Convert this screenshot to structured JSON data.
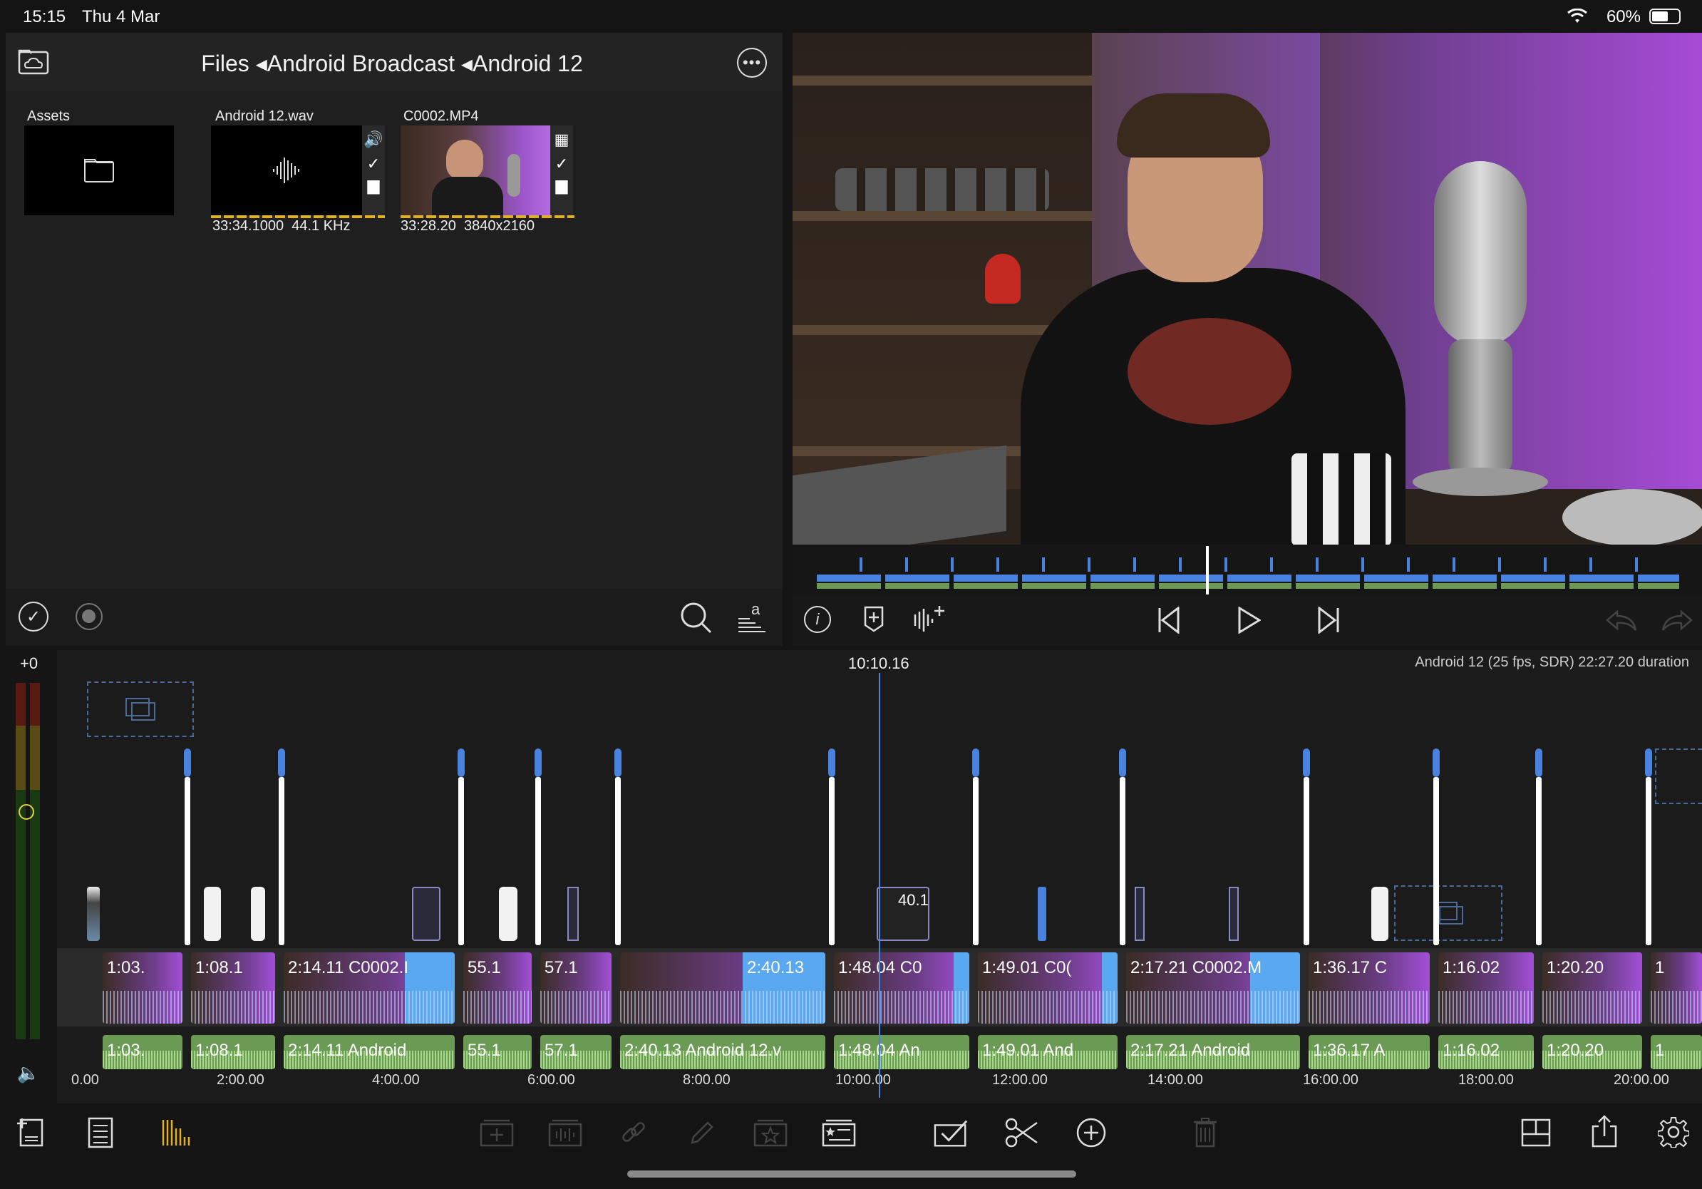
{
  "status": {
    "time": "15:15",
    "date": "Thu 4 Mar",
    "battery": "60%"
  },
  "browser": {
    "breadcrumb": "Files ◂Android Broadcast ◂Android 12",
    "assets": [
      {
        "label": "Assets"
      },
      {
        "label": "Android 12.wav",
        "duration": "33:34.1000",
        "detail": "44.1 KHz"
      },
      {
        "label": "C0002.MP4",
        "duration": "33:28.20",
        "detail": "3840x2160"
      }
    ]
  },
  "timeline": {
    "playhead": "10:10.16",
    "project_info": "Android 12 (25 fps, SDR)  22:27.20 duration",
    "level_offset": "+0",
    "ruler": [
      "0.00",
      "2:00.00",
      "4:00.00",
      "6:00.00",
      "8:00.00",
      "10:00.00",
      "12:00.00",
      "14:00.00",
      "16:00.00",
      "18:00.00",
      "20:00.00"
    ],
    "title_clip_text": "40.1",
    "video_clips": [
      {
        "label": "1:03."
      },
      {
        "label": "1:08.1"
      },
      {
        "label": "2:14.11   C0002.I"
      },
      {
        "label": "55.1"
      },
      {
        "label": "57.1"
      },
      {
        "label": "2:40.13"
      },
      {
        "label": "1:48.04   C0"
      },
      {
        "label": "1:49.01   C0("
      },
      {
        "label": "2:17.21   C0002.M"
      },
      {
        "label": "1:36.17   C"
      },
      {
        "label": "1:16.02"
      },
      {
        "label": "1:20.20"
      },
      {
        "label": "1"
      }
    ],
    "audio_clips": [
      {
        "label": "1:03."
      },
      {
        "label": "1:08.1"
      },
      {
        "label": "2:14.11   Android"
      },
      {
        "label": "55.1"
      },
      {
        "label": "57.1"
      },
      {
        "label": "2:40.13   Android 12.v"
      },
      {
        "label": "1:48.04   An"
      },
      {
        "label": "1:49.01   And"
      },
      {
        "label": "2:17.21   Android"
      },
      {
        "label": "1:36.17   A"
      },
      {
        "label": "1:16.02"
      },
      {
        "label": "1:20.20"
      },
      {
        "label": "1"
      }
    ]
  },
  "colors": {
    "accent": "#4a82e0",
    "audio_clip": "#6b9a55",
    "selection_tool": "#e0b028",
    "waveform": "#5aa8f0"
  }
}
